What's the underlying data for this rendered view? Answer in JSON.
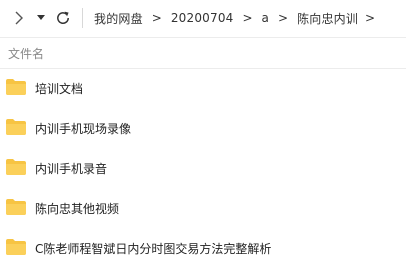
{
  "toolbar": {
    "forward_icon": "chevron-right-icon",
    "dropdown_icon": "caret-down-icon",
    "refresh_icon": "refresh-icon"
  },
  "breadcrumb": {
    "items": [
      "我的网盘",
      "20200704",
      "a",
      "陈向忠内训"
    ],
    "separator": ">"
  },
  "list": {
    "column_name": "文件名",
    "folder_color": "#f7c443",
    "files": [
      {
        "name": "培训文档",
        "type": "folder"
      },
      {
        "name": "内训手机现场录像",
        "type": "folder"
      },
      {
        "name": "内训手机录音",
        "type": "folder"
      },
      {
        "name": "陈向忠其他视频",
        "type": "folder"
      },
      {
        "name": "C陈老师程智斌日内分时图交易方法完整解析",
        "type": "folder"
      }
    ]
  }
}
